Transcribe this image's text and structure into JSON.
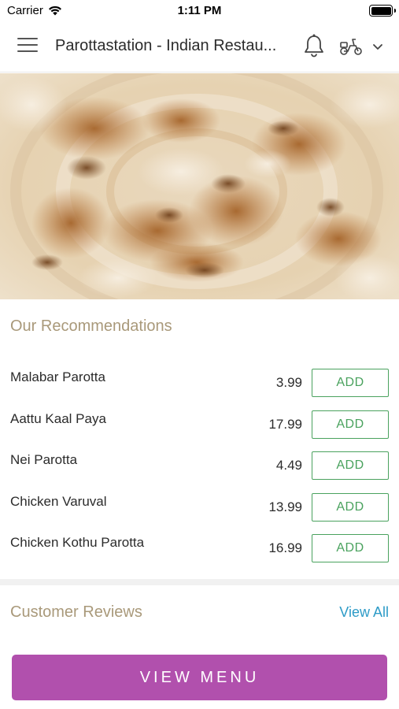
{
  "status_bar": {
    "carrier": "Carrier",
    "time": "1:11 PM"
  },
  "header": {
    "title": "Parottastation - Indian Restau...",
    "menu_icon": "hamburger-menu-icon",
    "notification_icon": "bell-icon",
    "delivery_icon": "scooter-icon",
    "dropdown_icon": "chevron-down-icon"
  },
  "hero": {
    "image": "parotta-food-photo"
  },
  "recommendations": {
    "title": "Our Recommendations",
    "items": [
      {
        "name": "Malabar Parotta",
        "price": "3.99",
        "add_label": "ADD"
      },
      {
        "name": "Aattu Kaal Paya",
        "price": "17.99",
        "add_label": "ADD"
      },
      {
        "name": "Nei Parotta",
        "price": "4.49",
        "add_label": "ADD"
      },
      {
        "name": "Chicken Varuval",
        "price": "13.99",
        "add_label": "ADD"
      },
      {
        "name": "Chicken Kothu Parotta",
        "price": "16.99",
        "add_label": "ADD"
      }
    ]
  },
  "reviews": {
    "title": "Customer Reviews",
    "view_all_label": "View All"
  },
  "footer": {
    "view_menu_label": "VIEW MENU"
  },
  "colors": {
    "accent_purple": "#b150ad",
    "add_green": "#4aa25e",
    "section_title": "#a9997a",
    "link_blue": "#2d9bc7"
  }
}
